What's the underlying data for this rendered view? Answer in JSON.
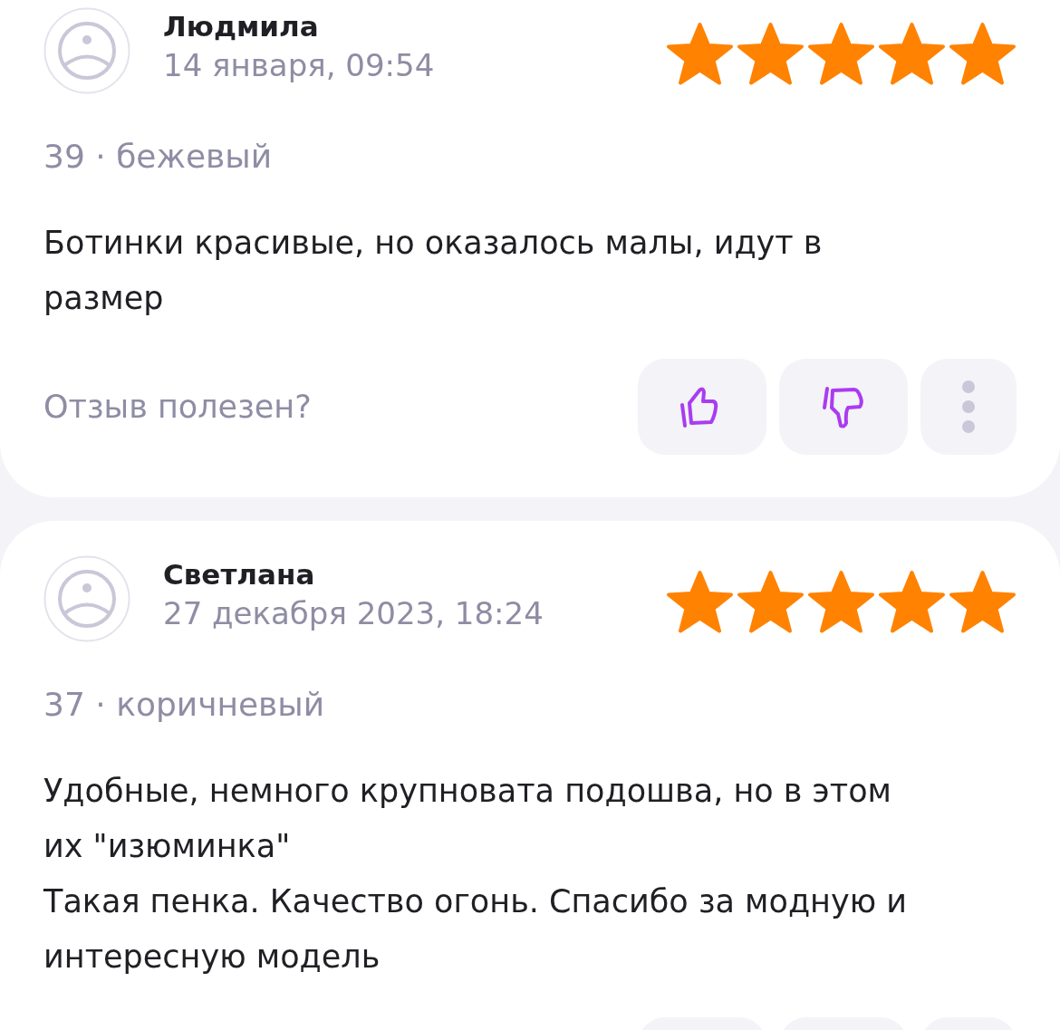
{
  "reviews": [
    {
      "author": "Людмила",
      "date": "14 января, 09:54",
      "stars": 5,
      "variant": "39 · бежевый",
      "text": "Ботинки красивые, но оказалось малы, идут в размер",
      "helpful_prompt": "Отзыв полезен?"
    },
    {
      "author": "Светлана",
      "date": "27 декабря 2023, 18:24",
      "stars": 5,
      "variant": "37 · коричневый",
      "text": "Удобные, немного крупновата подошва, но в этом их \"изюминка\"\n Такая пенка. Качество огонь. Спасибо за модную и интересную модель"
    }
  ]
}
